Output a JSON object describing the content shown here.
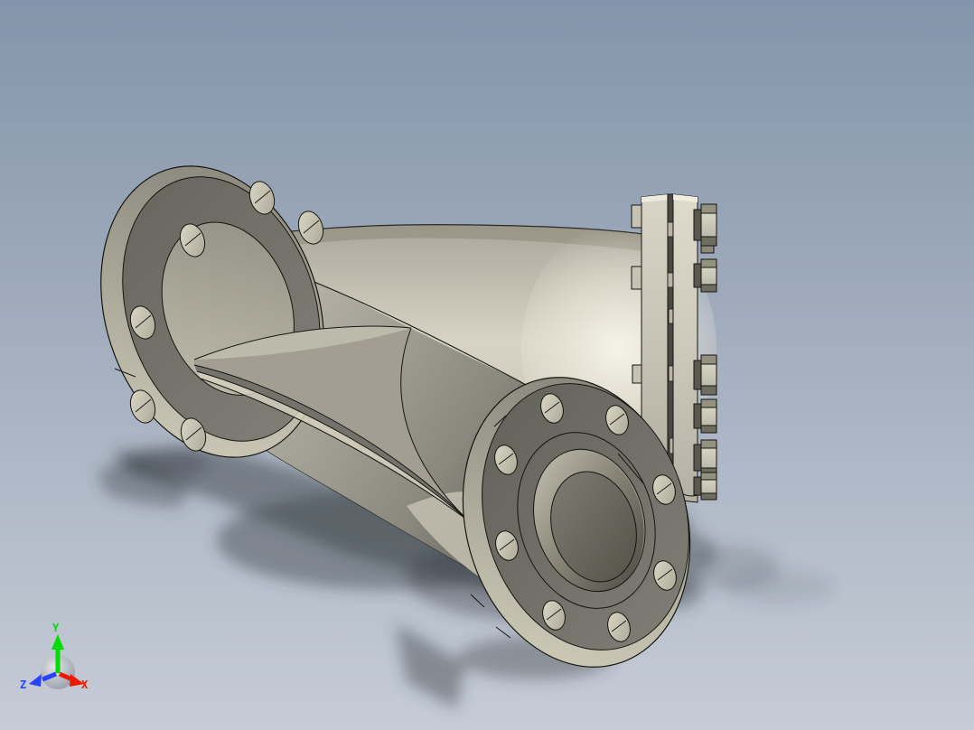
{
  "viewport": {
    "type": "3d-cad-shaded-view",
    "background_top": "#8494aa",
    "background_bottom": "#c6ccd6"
  },
  "part": {
    "name": "flanged-wye-strainer-body",
    "material_highlight": "#f6f4e8",
    "material_mid": "#cfccbc",
    "material_dark_face": "#6f6f68",
    "outline_color": "#15150f",
    "floor_shadow_color": "#3c4147"
  },
  "triad": {
    "x": {
      "label": "X",
      "color": "#ee1a00"
    },
    "y": {
      "label": "Y",
      "color": "#00dc00"
    },
    "z": {
      "label": "Z",
      "color": "#2743ff"
    }
  }
}
